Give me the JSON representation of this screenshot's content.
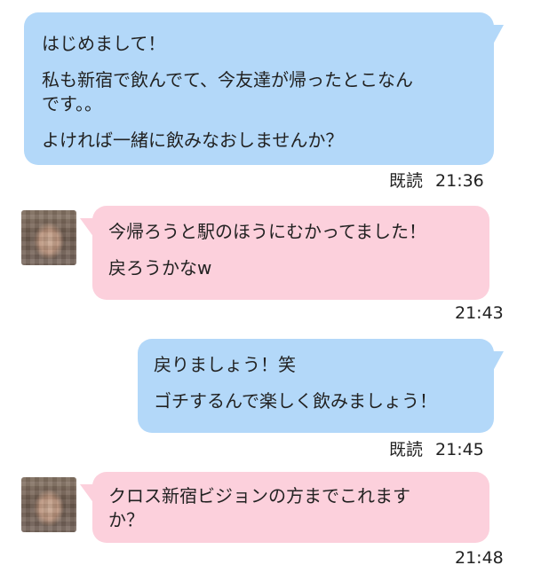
{
  "messages": [
    {
      "sender": "me",
      "lines": [
        "はじめまして！",
        "私も新宿で飲んでて、今友達が帰ったとこなん\nです。。",
        "よければ一緒に飲みなおしませんか？"
      ],
      "read": "既読",
      "time": "21:36"
    },
    {
      "sender": "them",
      "lines": [
        "今帰ろうと駅のほうにむかってました！",
        "戻ろうかなw"
      ],
      "time": "21:43"
    },
    {
      "sender": "me",
      "lines": [
        "戻りましょう！笑",
        "ゴチするんで楽しく飲みましょう！"
      ],
      "read": "既読",
      "time": "21:45"
    },
    {
      "sender": "them",
      "lines": [
        "クロス新宿ビジョンの方までこれます\nか？"
      ],
      "time": "21:48"
    }
  ],
  "colors": {
    "me_bubble": "#b3d8f9",
    "them_bubble": "#fcd0dc"
  },
  "icons": {
    "avatar": "blurred-profile-photo"
  }
}
